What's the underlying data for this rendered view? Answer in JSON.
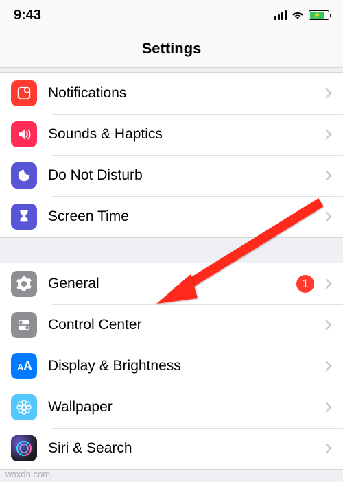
{
  "status": {
    "time": "9:43"
  },
  "title": "Settings",
  "sections": [
    {
      "rows": [
        {
          "icon": "notifications",
          "label": "Notifications"
        },
        {
          "icon": "sounds",
          "label": "Sounds & Haptics"
        },
        {
          "icon": "dnd",
          "label": "Do Not Disturb"
        },
        {
          "icon": "screentime",
          "label": "Screen Time"
        }
      ]
    },
    {
      "rows": [
        {
          "icon": "general",
          "label": "General",
          "badge": 1
        },
        {
          "icon": "controlcenter",
          "label": "Control Center"
        },
        {
          "icon": "display",
          "label": "Display & Brightness"
        },
        {
          "icon": "wallpaper",
          "label": "Wallpaper"
        },
        {
          "icon": "siri",
          "label": "Siri & Search"
        }
      ]
    }
  ],
  "colors": {
    "notifications": "#ff3b30",
    "sounds": "#ff2d55",
    "dnd": "#5856d6",
    "screentime": "#5856d6",
    "general": "#8e8e93",
    "controlcenter": "#8e8e93",
    "display": "#007aff",
    "wallpaper": "#54c7fc",
    "siri": "#1c1c1e"
  },
  "watermark": "wsxdn.com"
}
